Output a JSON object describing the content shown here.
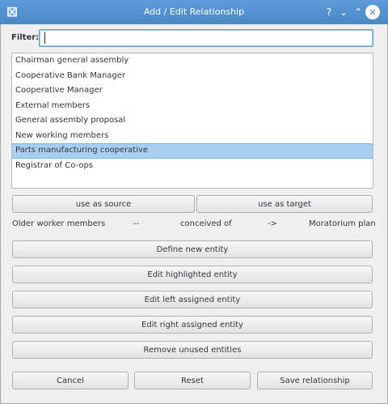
{
  "window": {
    "title": "Add / Edit Relationship",
    "buttons": {
      "help": "?",
      "minimize": "⌄",
      "maximize": "⌃",
      "close": "✕"
    }
  },
  "filter": {
    "label": "Filter:",
    "value": ""
  },
  "entities": [
    "Chairman general assembly",
    "Cooperative Bank Manager",
    "Cooperative Manager",
    "External members",
    "General assembly proposal",
    "New working members",
    "Parts manufacturing cooperative",
    "Registrar of Co-ops"
  ],
  "selected_entity": "Parts manufacturing cooperative",
  "assign_buttons": {
    "source": "use as source",
    "target": "use as target"
  },
  "relationship": {
    "source": "Older worker members",
    "separator1": "--",
    "verb": "conceived of",
    "arrow": "->",
    "target": "Moratorium plan"
  },
  "actions": {
    "define": "Define new entity",
    "edit_highlighted": "Edit highlighted entity",
    "edit_left": "Edit left assigned entity",
    "edit_right": "Edit right assigned entity",
    "remove_unused": "Remove unused entities"
  },
  "footer": {
    "cancel": "Cancel",
    "reset": "Reset",
    "save": "Save relationship"
  }
}
